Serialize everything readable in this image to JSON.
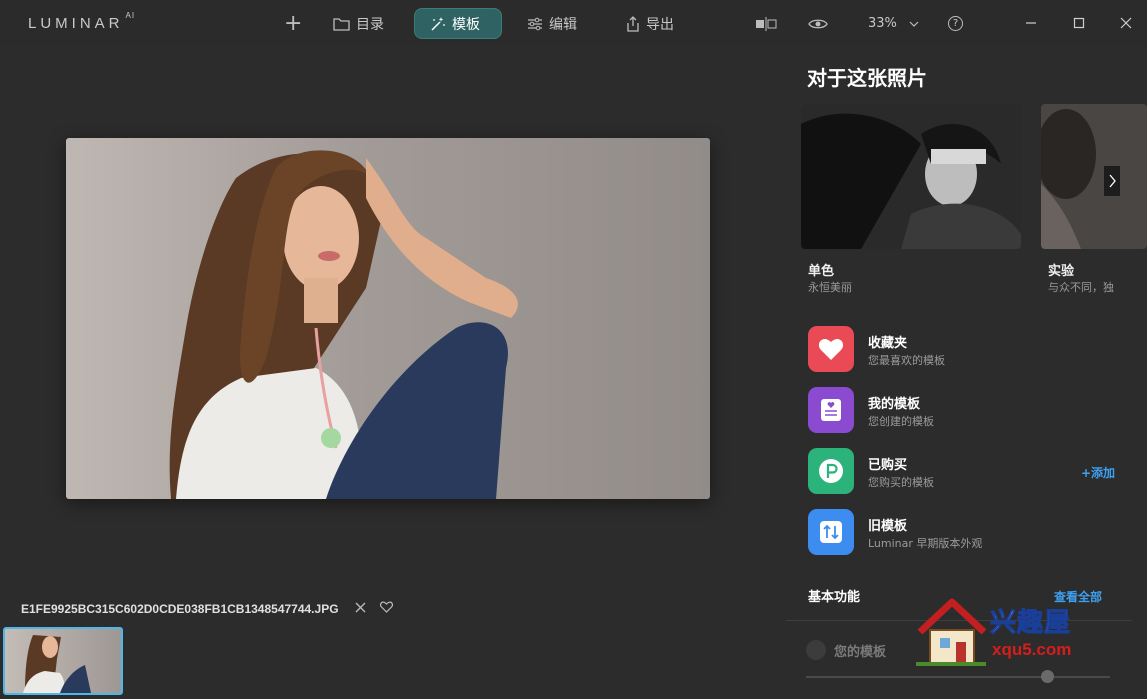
{
  "app": {
    "logo": "LUMINAR",
    "logo_suffix": "AI"
  },
  "toolbar": {
    "add_label": "+",
    "catalog_label": "目录",
    "templates_label": "模板",
    "edit_label": "编辑",
    "export_label": "导出",
    "zoom_value": "33%",
    "help_label": "?"
  },
  "canvas": {
    "filename": "E1FE9925BC315C602D0CDE038FB1CB1348547744.JPG"
  },
  "panel": {
    "title": "对于这张照片",
    "cards": [
      {
        "name": "单色",
        "desc": "永恒美丽"
      },
      {
        "name": "实验",
        "desc": "与众不同，独"
      }
    ],
    "categories": [
      {
        "title": "收藏夹",
        "sub": "您最喜欢的模板",
        "color": "#e94a55"
      },
      {
        "title": "我的模板",
        "sub": "您创建的模板",
        "color": "#8b4bd0"
      },
      {
        "title": "已购买",
        "sub": "您购买的模板",
        "color": "#2bb37b"
      },
      {
        "title": "旧模板",
        "sub": "Luminar 早期版本外观",
        "color": "#3d8cf0"
      }
    ],
    "add_label": "+添加",
    "section_title": "基本功能",
    "view_all": "查看全部",
    "preset_label": "您的模板"
  },
  "watermark": {
    "text": "兴趣屋",
    "url": "xqu5.com"
  },
  "colors": {
    "accent": "#2f6263",
    "link": "#3ea0f0",
    "thumb_border": "#4fb6e8"
  }
}
